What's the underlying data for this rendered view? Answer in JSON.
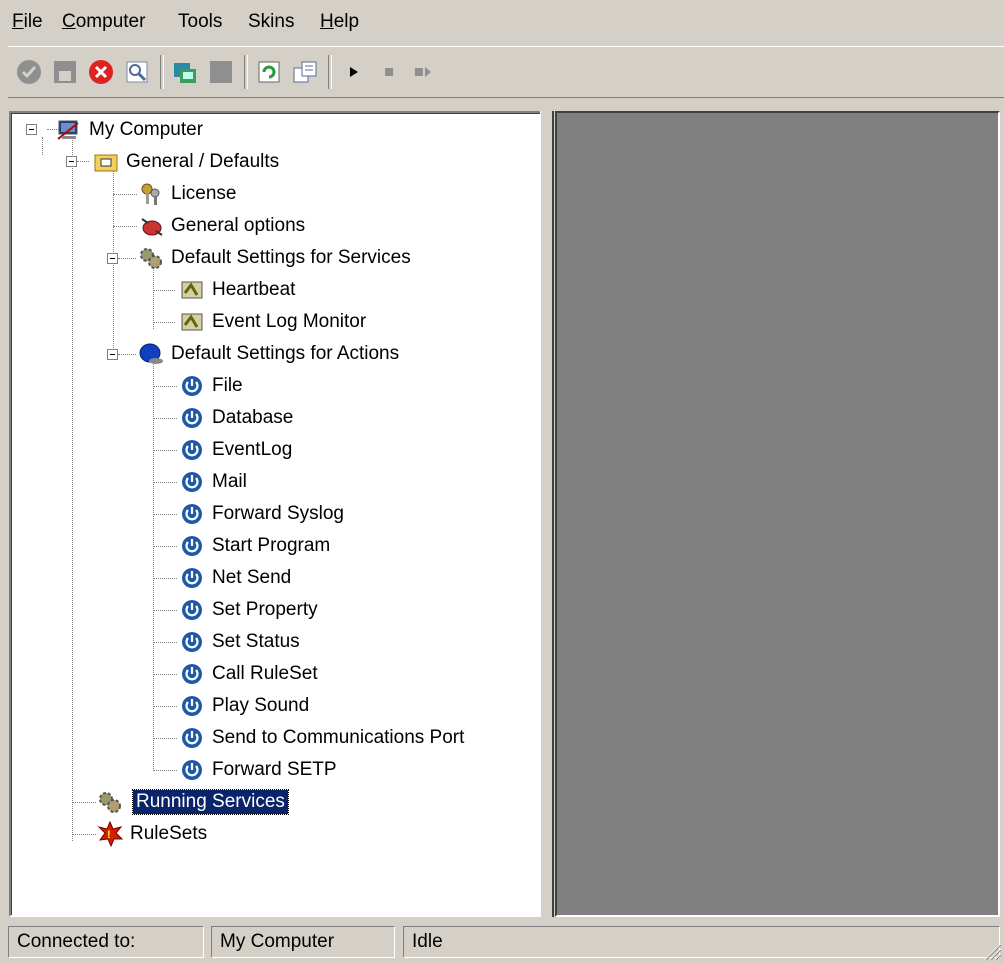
{
  "menu": {
    "items": [
      "File",
      "Computer",
      "Tools",
      "Skins",
      "Help"
    ]
  },
  "toolbar": {
    "buttons": [
      "ok-icon",
      "save-icon",
      "stop-error-icon",
      "search-config-icon",
      "computer-connect-icon",
      "disabled-monitor-icon",
      "refresh-icon",
      "settings-icon",
      "play-icon",
      "stop-icon",
      "step-icon"
    ]
  },
  "tree": {
    "root": "My Computer",
    "general": "General / Defaults",
    "license": "License",
    "general_options": "General options",
    "default_services": "Default Settings for Services",
    "services": [
      "Heartbeat",
      "Event Log Monitor"
    ],
    "default_actions": "Default Settings for Actions",
    "actions": [
      "File",
      "Database",
      "EventLog",
      "Mail",
      "Forward Syslog",
      "Start Program",
      "Net Send",
      "Set Property",
      "Set Status",
      "Call RuleSet",
      "Play Sound",
      "Send to Communications Port",
      "Forward SETP"
    ],
    "running_services": "Running Services",
    "rulesets": "RuleSets"
  },
  "status": {
    "connected_label": "Connected to:",
    "computer": "My Computer",
    "state": "Idle"
  },
  "colors": {
    "selection": "#0a246a",
    "face": "#d4d0c8",
    "empty_pane": "#808080",
    "action_icon": "#1e5aa8"
  }
}
